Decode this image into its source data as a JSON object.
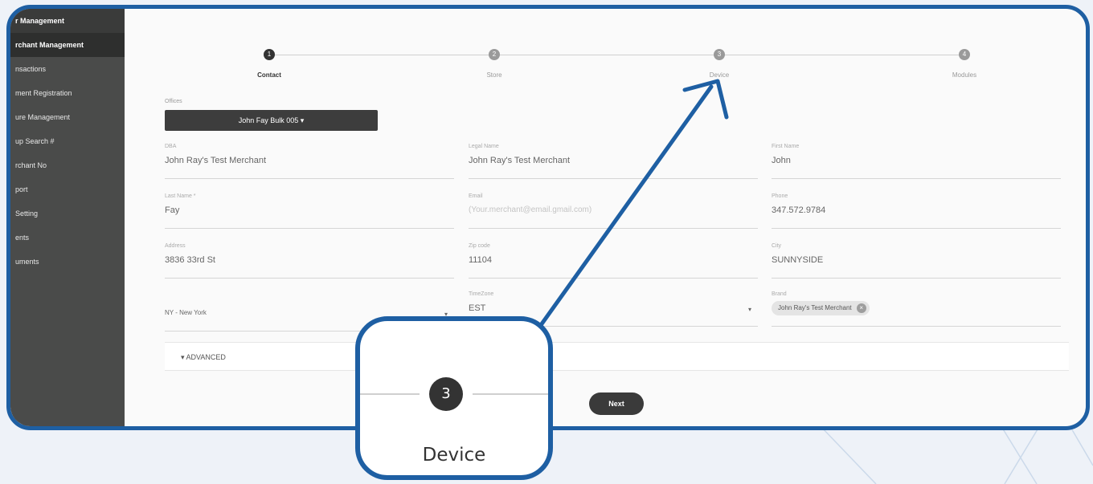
{
  "sidebar": {
    "header": "r Management",
    "items": [
      {
        "label": "rchant Management",
        "active": true
      },
      {
        "label": "nsactions"
      },
      {
        "label": "ment Registration"
      },
      {
        "label": "ure Management"
      },
      {
        "label": "up Search #"
      },
      {
        "label": "rchant No"
      },
      {
        "label": "port"
      },
      {
        "label": "Setting"
      },
      {
        "label": "ents"
      },
      {
        "label": "uments"
      }
    ]
  },
  "stepper": {
    "steps": [
      {
        "number": "1",
        "label": "Contact",
        "active": true
      },
      {
        "number": "2",
        "label": "Store",
        "active": false
      },
      {
        "number": "3",
        "label": "Device",
        "active": false
      },
      {
        "number": "4",
        "label": "Modules",
        "active": false
      }
    ]
  },
  "form": {
    "offices_label": "Offices",
    "offices_value": "John Fay Bulk 005 ▾",
    "dba_label": "DBA",
    "dba_value": "John Ray's Test Merchant",
    "legal_name_label": "Legal Name",
    "legal_name_value": "John Ray's Test Merchant",
    "first_name_label": "First Name",
    "first_name_value": "John",
    "last_name_label": "Last Name *",
    "last_name_value": "Fay",
    "email_label": "Email",
    "email_placeholder": "(Your.merchant@email.gmail.com)",
    "phone_label": "Phone",
    "phone_value": "347.572.9784",
    "address_label": "Address",
    "address_value": "3836 33rd St",
    "zipcode_label": "Zip code",
    "zipcode_value": "11104",
    "city_label": "City",
    "city_value": "SUNNYSIDE",
    "state_value": "NY - New York",
    "timezone_label": "TimeZone",
    "timezone_value": "EST",
    "brand_label": "Brand",
    "brand_chip": "John Ray's Test Merchant",
    "advanced_label": "ADVANCED",
    "next_label": "Next"
  },
  "zoom": {
    "step_number": "3",
    "step_label": "Device"
  },
  "colors": {
    "frame": "#1e5fa3",
    "sidebar": "#4a4b4a",
    "dark_button": "#3a3a3a"
  }
}
